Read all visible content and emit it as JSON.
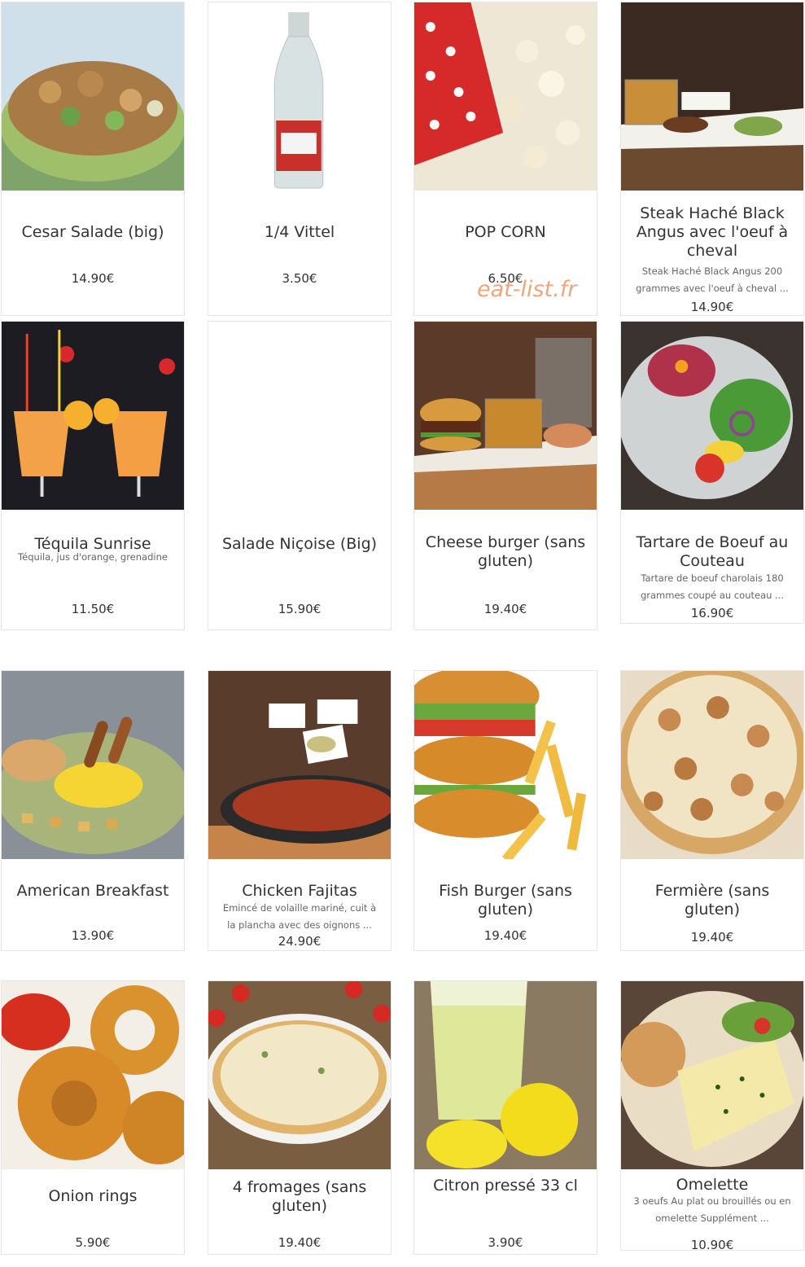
{
  "watermark": "eat-list.fr",
  "items": [
    {
      "name": "Cesar Salade (big)",
      "desc": "",
      "price": "14.90€",
      "icon": "salad-image"
    },
    {
      "name": "1/4 Vittel",
      "desc": "",
      "price": "3.50€",
      "icon": "water-bottle-image"
    },
    {
      "name": "POP CORN",
      "desc": "",
      "price": "6.50€",
      "icon": "popcorn-image"
    },
    {
      "name": "Steak Haché Black Angus avec l'oeuf à cheval",
      "desc": "Steak Haché Black Angus 200 grammes avec l'oeuf à cheval ...",
      "price": "14.90€",
      "icon": "steak-plate-image"
    },
    {
      "name": "Téquila Sunrise",
      "desc": "Téquila, jus d'orange, grenadine",
      "price": "11.50€",
      "icon": "cocktail-image"
    },
    {
      "name": "Salade Niçoise (Big)",
      "desc": "",
      "price": "15.90€",
      "icon": "blank-image"
    },
    {
      "name": "Cheese burger (sans gluten)",
      "desc": "",
      "price": "19.40€",
      "icon": "burger-plate-image"
    },
    {
      "name": "Tartare de Boeuf au Couteau",
      "desc": "Tartare de boeuf charolais 180 grammes coupé au couteau ...",
      "price": "16.90€",
      "icon": "tartare-image"
    },
    {
      "name": "American Breakfast",
      "desc": "",
      "price": "13.90€",
      "icon": "breakfast-image"
    },
    {
      "name": "Chicken Fajitas",
      "desc": "Emincé de volaille mariné, cuit à la plancha avec des oignons ...",
      "price": "24.90€",
      "icon": "fajitas-image"
    },
    {
      "name": "Fish Burger (sans gluten)",
      "desc": "",
      "price": "19.40€",
      "icon": "fish-burger-image"
    },
    {
      "name": "Fermière (sans gluten)",
      "desc": "",
      "price": "19.40€",
      "icon": "pizza-image"
    },
    {
      "name": "Onion rings",
      "desc": "",
      "price": "5.90€",
      "icon": "onion-rings-image"
    },
    {
      "name": "4 fromages (sans gluten)",
      "desc": "",
      "price": "19.40€",
      "icon": "cheese-pizza-image"
    },
    {
      "name": "Citron pressé 33 cl",
      "desc": "",
      "price": "3.90€",
      "icon": "lemonade-image"
    },
    {
      "name": "Omelette",
      "desc": "3 oeufs Au plat ou brouillés ou en omelette Supplément ...",
      "price": "10.90€",
      "icon": "omelette-image"
    }
  ]
}
